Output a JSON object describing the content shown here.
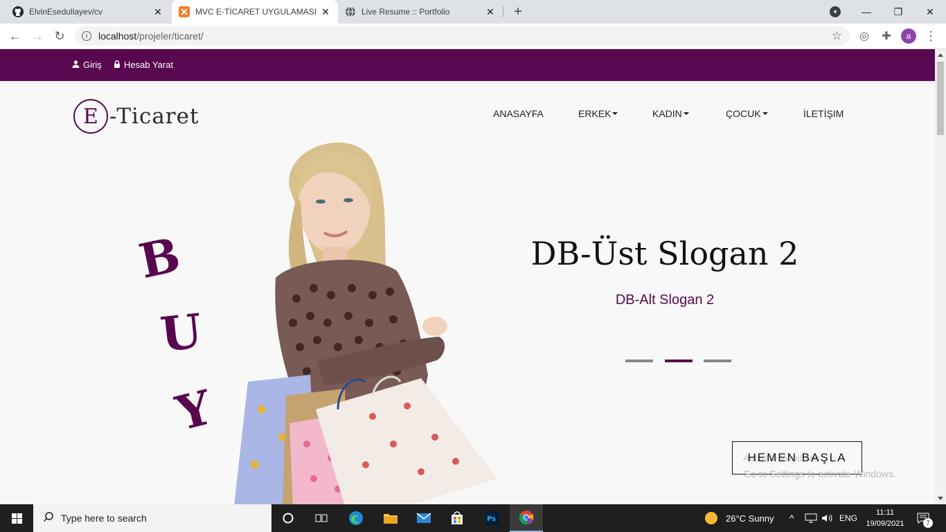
{
  "browser": {
    "tabs": [
      {
        "title": "ElvinEsedullayev/cv",
        "favicon": "github-icon",
        "active": false
      },
      {
        "title": "MVC E-TİCARET UYGULAMASI",
        "favicon": "xampp-icon",
        "active": true
      },
      {
        "title": "Live Resume :: Portfolio",
        "favicon": "globe-icon",
        "active": false
      }
    ],
    "url_host": "localhost",
    "url_path": "/projeler/ticaret/",
    "profile_initial": "a"
  },
  "site": {
    "top_links": {
      "login": "Giriş",
      "register": "Hesab Yarat"
    },
    "logo": {
      "initial": "E",
      "rest": "-Ticaret"
    },
    "menu": {
      "home": "ANASAYFA",
      "men": "ERKEK",
      "women": "KADIN",
      "kids": "ÇOCUK",
      "contact": "İLETİŞIM"
    },
    "hero": {
      "buy_letters": [
        "B",
        "U",
        "Y"
      ],
      "headline": "DB-Üst Slogan 2",
      "subheadline": "DB-Alt Slogan 2",
      "active_slide": 2,
      "slide_count": 3,
      "cta": "HEMEN BAŞLA"
    },
    "watermark": {
      "line1": "Activate Windows",
      "line2": "Go to Settings to activate Windows."
    },
    "accent_color": "#58084f"
  },
  "taskbar": {
    "search_placeholder": "Type here to search",
    "weather": "26°C  Sunny",
    "language": "ENG",
    "time": "11:11",
    "date": "19/09/2021",
    "notification_count": "7"
  }
}
